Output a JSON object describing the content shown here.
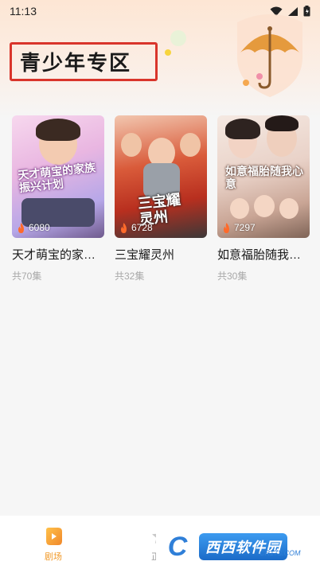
{
  "status_bar": {
    "time": "11:13"
  },
  "page": {
    "title": "青少年专区"
  },
  "dramas": [
    {
      "title": "天才萌宝的家…",
      "episodes": "共70集",
      "views": "6080",
      "poster_text": "天才萌宝的家族振兴计划"
    },
    {
      "title": "三宝耀灵州",
      "episodes": "共32集",
      "views": "6728",
      "poster_text": "三宝耀灵州"
    },
    {
      "title": "如意福胎随我…",
      "episodes": "共30集",
      "views": "7297",
      "poster_text": "如意福胎随我心意"
    }
  ],
  "bottom_nav": {
    "items": [
      {
        "label": "剧场",
        "icon": "theater-play-icon",
        "active": true
      },
      {
        "label": "正在",
        "icon": "star-icon",
        "active": false
      }
    ]
  },
  "watermark": {
    "logo": "C",
    "text": "西西软件园",
    "sub": "CR173.COM"
  },
  "colors": {
    "accent": "#f19a2a",
    "title_border": "#d9352b"
  }
}
